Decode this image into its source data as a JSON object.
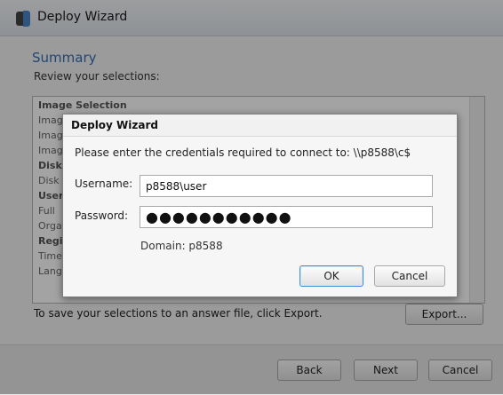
{
  "window": {
    "title": "Deploy Wizard",
    "summary_title": "Summary",
    "summary_subtitle": "Review your selections:",
    "list_items": [
      {
        "text": "Image Selection",
        "header": true
      },
      {
        "text": "Image",
        "header": false
      },
      {
        "text": "Image",
        "header": false
      },
      {
        "text": "Image",
        "header": false
      },
      {
        "text": "Disk",
        "header": true
      },
      {
        "text": "Disk",
        "header": false
      },
      {
        "text": "User",
        "header": true
      },
      {
        "text": "Full",
        "header": false
      },
      {
        "text": "Orga",
        "header": false
      },
      {
        "text": "Regi",
        "header": true
      },
      {
        "text": "Time",
        "header": false
      },
      {
        "text": "Lang",
        "header": false
      }
    ],
    "footer_text": "To save your selections to an answer file, click Export.",
    "export_label": "Export...",
    "back_label": "Back",
    "next_label": "Next",
    "cancel_label": "Cancel"
  },
  "dialog": {
    "title": "Deploy Wizard",
    "prompt": "Please enter the credentials required to connect to: \\\\p8588\\c$",
    "username_label": "Username:",
    "username_value": "p8588\\user",
    "password_label": "Password:",
    "password_value": "●●●●●●●●●●●",
    "domain_text": "Domain: p8588",
    "ok_label": "OK",
    "cancel_label": "Cancel"
  }
}
